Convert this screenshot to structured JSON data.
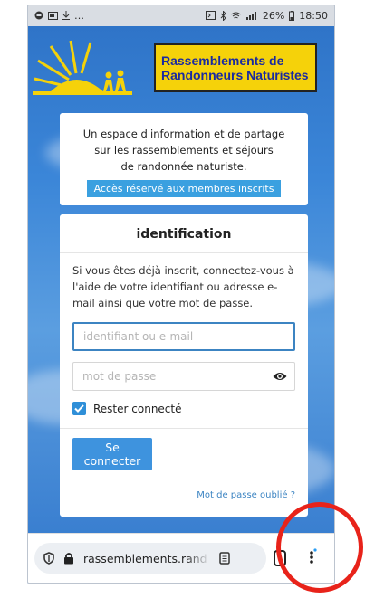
{
  "status_bar": {
    "left_text": "…",
    "battery": "26%",
    "time": "18:50"
  },
  "header": {
    "banner_line1": "Rassemblements de",
    "banner_line2": "Randonneurs Naturistes"
  },
  "info_card": {
    "line1": "Un espace d'information et de partage",
    "line2": "sur les rassemblements et séjours",
    "line3": "de randonnée naturiste.",
    "access_badge": "Accès réservé aux membres inscrits"
  },
  "login": {
    "title": "identification",
    "intro": "Si vous êtes déjà inscrit, connectez-vous à l'aide de votre identifiant ou adresse e-mail ainsi que votre mot de passe.",
    "username_placeholder": "identifiant ou e-mail",
    "password_placeholder": "mot de passe",
    "remember_label": "Rester connecté",
    "remember_checked": true,
    "submit_label": "Se connecter",
    "forgot_label": "Mot de passe oublié ?"
  },
  "browser": {
    "url": "rassemblements.rand"
  },
  "colors": {
    "sky": "#2f74c8",
    "banner": "#f5d20a",
    "accent": "#3e93de",
    "annotation": "#e8231a"
  }
}
